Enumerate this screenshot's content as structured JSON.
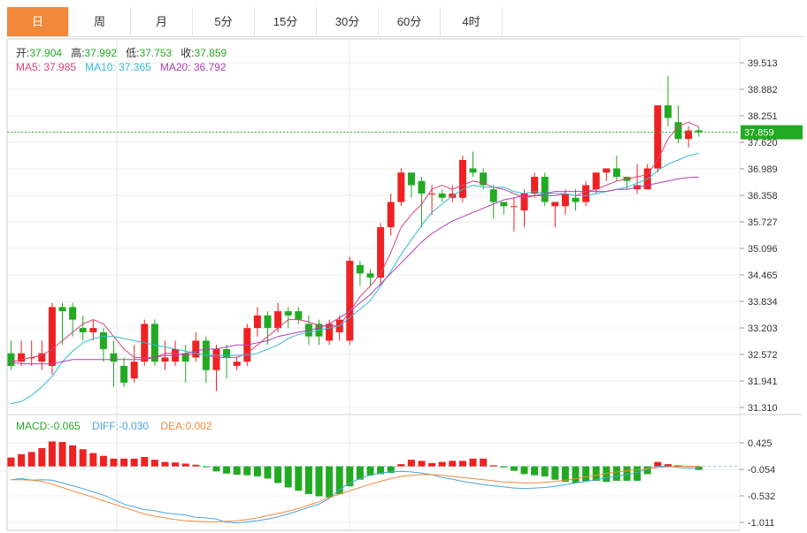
{
  "tabs": [
    "日",
    "周",
    "月",
    "5分",
    "15分",
    "30分",
    "60分",
    "4时"
  ],
  "active_tab": 0,
  "ohlc_info": {
    "open_label": "开:",
    "open": "37.904",
    "high_label": "高:",
    "high": "37.992",
    "low_label": "低:",
    "low": "37.753",
    "close_label": "收:",
    "close": "37.859"
  },
  "ma_info": {
    "ma5_label": "MA5:",
    "ma5": "37.985",
    "ma10_label": "MA10:",
    "ma10": "37.365",
    "ma20_label": "MA20:",
    "ma20": "36.792"
  },
  "macd_info": {
    "macd_label": "MACD:",
    "macd": "-0.065",
    "diff_label": "DIFF:",
    "diff": "-0.030",
    "dea_label": "DEA:",
    "dea": "0.002"
  },
  "current_price_label": "37.859",
  "colors": {
    "up": "#ee2222",
    "down": "#22aa22",
    "ma5": "#e0407a",
    "ma10": "#34b8d8",
    "ma20": "#b040b0",
    "diff": "#4aa3e0",
    "dea": "#f08a3a",
    "price_line": "#22aa22",
    "active_tab": "#f08a3a"
  },
  "chart_data": [
    {
      "type": "candlestick",
      "yticks": [
        39.513,
        38.882,
        38.251,
        37.62,
        36.989,
        36.358,
        35.727,
        35.096,
        34.465,
        33.834,
        33.203,
        32.572,
        31.941,
        31.31
      ],
      "ylim": [
        31.31,
        39.513
      ],
      "current_price": 37.859,
      "candles": [
        [
          32.6,
          32.3,
          32.9,
          32.2
        ],
        [
          32.4,
          32.6,
          32.9,
          32.3
        ],
        [
          32.5,
          32.5,
          32.9,
          32.3
        ],
        [
          32.4,
          32.6,
          32.9,
          32.2
        ],
        [
          32.3,
          33.7,
          33.8,
          32.1
        ],
        [
          33.7,
          33.6,
          33.8,
          32.8
        ],
        [
          33.7,
          33.4,
          33.8,
          33.0
        ],
        [
          33.2,
          33.1,
          33.5,
          32.9
        ],
        [
          33.1,
          33.2,
          33.4,
          32.9
        ],
        [
          33.1,
          32.7,
          33.2,
          32.4
        ],
        [
          32.6,
          32.4,
          32.9,
          31.8
        ],
        [
          32.3,
          31.9,
          32.5,
          31.8
        ],
        [
          32.0,
          32.4,
          32.8,
          31.9
        ],
        [
          32.4,
          33.3,
          33.4,
          32.3
        ],
        [
          33.3,
          32.4,
          33.4,
          32.3
        ],
        [
          32.4,
          32.5,
          32.9,
          32.2
        ],
        [
          32.4,
          32.7,
          32.9,
          32.3
        ],
        [
          32.6,
          32.4,
          32.8,
          31.9
        ],
        [
          32.5,
          32.9,
          33.1,
          32.4
        ],
        [
          32.9,
          32.2,
          33.0,
          31.9
        ],
        [
          32.2,
          32.7,
          32.8,
          31.7
        ],
        [
          32.7,
          32.5,
          32.8,
          32.0
        ],
        [
          32.3,
          32.4,
          32.5,
          32.2
        ],
        [
          32.4,
          33.2,
          33.3,
          32.3
        ],
        [
          33.2,
          33.5,
          33.7,
          33.0
        ],
        [
          33.5,
          33.2,
          33.6,
          32.8
        ],
        [
          33.2,
          33.6,
          33.8,
          33.1
        ],
        [
          33.6,
          33.5,
          33.7,
          33.2
        ],
        [
          33.6,
          33.4,
          33.7,
          33.3
        ],
        [
          33.3,
          33.0,
          33.5,
          32.8
        ],
        [
          33.3,
          33.0,
          33.4,
          32.8
        ],
        [
          32.9,
          33.3,
          33.4,
          32.8
        ],
        [
          33.1,
          33.4,
          33.5,
          32.9
        ],
        [
          32.9,
          34.8,
          34.9,
          32.8
        ],
        [
          34.7,
          34.5,
          34.8,
          34.2
        ],
        [
          34.5,
          34.4,
          34.6,
          34.2
        ],
        [
          34.4,
          35.6,
          35.7,
          34.2
        ],
        [
          35.6,
          36.2,
          36.4,
          35.4
        ],
        [
          36.2,
          36.9,
          37.0,
          36.1
        ],
        [
          36.9,
          36.6,
          36.9,
          36.3
        ],
        [
          36.7,
          36.4,
          36.8,
          35.6
        ],
        [
          36.4,
          36.4,
          36.6,
          35.9
        ],
        [
          36.4,
          36.3,
          36.5,
          36.2
        ],
        [
          36.3,
          36.4,
          36.6,
          36.2
        ],
        [
          36.3,
          37.2,
          37.3,
          36.2
        ],
        [
          37.0,
          36.9,
          37.4,
          36.8
        ],
        [
          36.9,
          36.6,
          37.0,
          36.5
        ],
        [
          36.5,
          36.2,
          36.6,
          35.8
        ],
        [
          36.2,
          36.1,
          36.2,
          35.9
        ],
        [
          36.1,
          36.1,
          36.3,
          35.5
        ],
        [
          36.0,
          36.4,
          36.5,
          35.6
        ],
        [
          36.4,
          36.8,
          36.9,
          36.3
        ],
        [
          36.8,
          36.2,
          36.9,
          36.1
        ],
        [
          36.1,
          36.2,
          36.2,
          35.6
        ],
        [
          36.1,
          36.4,
          36.5,
          35.9
        ],
        [
          36.3,
          36.2,
          36.5,
          36.0
        ],
        [
          36.2,
          36.6,
          36.7,
          36.1
        ],
        [
          36.5,
          36.9,
          36.9,
          36.4
        ],
        [
          36.9,
          37.0,
          37.0,
          36.7
        ],
        [
          37.0,
          36.8,
          37.3,
          36.7
        ],
        [
          36.8,
          36.7,
          36.8,
          36.5
        ],
        [
          36.5,
          36.6,
          37.1,
          36.4
        ],
        [
          36.5,
          37.0,
          37.1,
          36.5
        ],
        [
          37.0,
          38.5,
          38.5,
          36.9
        ],
        [
          38.5,
          38.2,
          39.2,
          38.0
        ],
        [
          38.1,
          37.7,
          38.5,
          37.6
        ],
        [
          37.7,
          37.9,
          38.0,
          37.5
        ],
        [
          37.904,
          37.859,
          37.992,
          37.753
        ]
      ],
      "ma5": [
        32.4,
        32.45,
        32.5,
        32.55,
        32.7,
        32.9,
        33.1,
        33.3,
        33.4,
        33.3,
        33.0,
        32.7,
        32.5,
        32.5,
        32.5,
        32.6,
        32.6,
        32.55,
        32.6,
        32.55,
        32.5,
        32.5,
        32.5,
        32.6,
        32.8,
        33.0,
        33.2,
        33.4,
        33.4,
        33.35,
        33.25,
        33.25,
        33.25,
        33.6,
        33.95,
        34.2,
        34.5,
        35.0,
        35.6,
        35.9,
        36.15,
        36.5,
        36.6,
        36.5,
        36.6,
        36.7,
        36.65,
        36.55,
        36.5,
        36.4,
        36.3,
        36.35,
        36.35,
        36.35,
        36.4,
        36.35,
        36.45,
        36.5,
        36.6,
        36.7,
        36.75,
        36.8,
        36.85,
        37.2,
        37.7,
        38.0,
        38.1,
        37.985
      ],
      "ma10": [
        31.4,
        31.45,
        31.6,
        31.8,
        32.05,
        32.4,
        32.65,
        32.85,
        32.95,
        33.0,
        33.0,
        32.95,
        32.9,
        32.85,
        32.8,
        32.75,
        32.7,
        32.65,
        32.6,
        32.55,
        32.55,
        32.55,
        32.55,
        32.55,
        32.6,
        32.7,
        32.8,
        32.95,
        33.05,
        33.1,
        33.15,
        33.2,
        33.25,
        33.45,
        33.65,
        33.85,
        34.2,
        34.55,
        34.95,
        35.3,
        35.65,
        35.95,
        36.15,
        36.35,
        36.5,
        36.6,
        36.55,
        36.55,
        36.55,
        36.45,
        36.4,
        36.45,
        36.4,
        36.4,
        36.4,
        36.35,
        36.35,
        36.4,
        36.45,
        36.5,
        36.55,
        36.65,
        36.75,
        36.95,
        37.1,
        37.2,
        37.3,
        37.365
      ],
      "ma20": [
        32.4,
        32.35,
        32.35,
        32.35,
        32.35,
        32.4,
        32.45,
        32.45,
        32.45,
        32.45,
        32.45,
        32.45,
        32.45,
        32.45,
        32.5,
        32.55,
        32.55,
        32.6,
        32.65,
        32.7,
        32.7,
        32.75,
        32.8,
        32.8,
        32.85,
        32.9,
        33.0,
        33.05,
        33.1,
        33.15,
        33.2,
        33.3,
        33.45,
        33.6,
        33.8,
        34.0,
        34.25,
        34.5,
        34.75,
        35.0,
        35.25,
        35.45,
        35.6,
        35.75,
        35.85,
        35.95,
        36.05,
        36.15,
        36.25,
        36.3,
        36.35,
        36.35,
        36.4,
        36.45,
        36.45,
        36.45,
        36.45,
        36.45,
        36.45,
        36.5,
        36.5,
        36.55,
        36.6,
        36.65,
        36.7,
        36.75,
        36.78,
        36.792
      ]
    },
    {
      "type": "macd",
      "yticks": [
        0.425,
        -0.054,
        -0.532,
        -1.011
      ],
      "ylim": [
        -1.011,
        0.425
      ],
      "histogram": [
        0.16,
        0.22,
        0.26,
        0.33,
        0.45,
        0.44,
        0.38,
        0.31,
        0.24,
        0.19,
        0.14,
        0.14,
        0.14,
        0.17,
        0.12,
        0.08,
        0.07,
        0.05,
        0.03,
        -0.01,
        -0.09,
        -0.13,
        -0.15,
        -0.16,
        -0.18,
        -0.22,
        -0.3,
        -0.38,
        -0.44,
        -0.5,
        -0.54,
        -0.56,
        -0.5,
        -0.36,
        -0.24,
        -0.16,
        -0.14,
        -0.12,
        0.04,
        0.12,
        0.1,
        0.06,
        0.08,
        0.1,
        0.1,
        0.14,
        0.14,
        0.02,
        -0.02,
        -0.08,
        -0.14,
        -0.16,
        -0.18,
        -0.24,
        -0.28,
        -0.3,
        -0.27,
        -0.26,
        -0.28,
        -0.26,
        -0.26,
        -0.26,
        -0.14,
        0.08,
        0.04,
        0.02,
        0.01,
        -0.065
      ],
      "diff": [
        -0.24,
        -0.22,
        -0.25,
        -0.24,
        -0.25,
        -0.3,
        -0.35,
        -0.4,
        -0.46,
        -0.52,
        -0.6,
        -0.68,
        -0.73,
        -0.78,
        -0.8,
        -0.84,
        -0.86,
        -0.88,
        -0.92,
        -0.93,
        -0.95,
        -1.01,
        -1.02,
        -1.0,
        -0.98,
        -0.95,
        -0.91,
        -0.86,
        -0.8,
        -0.74,
        -0.68,
        -0.58,
        -0.42,
        -0.3,
        -0.22,
        -0.16,
        -0.12,
        -0.1,
        -0.09,
        -0.1,
        -0.12,
        -0.15,
        -0.2,
        -0.23,
        -0.27,
        -0.3,
        -0.33,
        -0.35,
        -0.37,
        -0.39,
        -0.4,
        -0.39,
        -0.38,
        -0.36,
        -0.33,
        -0.3,
        -0.27,
        -0.24,
        -0.21,
        -0.18,
        -0.15,
        -0.11,
        -0.05,
        0.0,
        0.0,
        -0.02,
        -0.03,
        -0.03
      ],
      "dea": [
        -0.24,
        -0.24,
        -0.25,
        -0.27,
        -0.32,
        -0.38,
        -0.44,
        -0.5,
        -0.56,
        -0.62,
        -0.68,
        -0.74,
        -0.8,
        -0.86,
        -0.9,
        -0.93,
        -0.96,
        -0.98,
        -0.99,
        -1.0,
        -1.0,
        -0.99,
        -0.98,
        -0.96,
        -0.93,
        -0.89,
        -0.85,
        -0.81,
        -0.76,
        -0.7,
        -0.64,
        -0.56,
        -0.5,
        -0.44,
        -0.38,
        -0.32,
        -0.27,
        -0.22,
        -0.18,
        -0.16,
        -0.15,
        -0.15,
        -0.16,
        -0.18,
        -0.2,
        -0.22,
        -0.24,
        -0.26,
        -0.28,
        -0.29,
        -0.3,
        -0.3,
        -0.29,
        -0.27,
        -0.25,
        -0.22,
        -0.19,
        -0.16,
        -0.13,
        -0.1,
        -0.08,
        -0.06,
        -0.04,
        -0.02,
        -0.01,
        0.0,
        0.0,
        0.002
      ]
    }
  ]
}
